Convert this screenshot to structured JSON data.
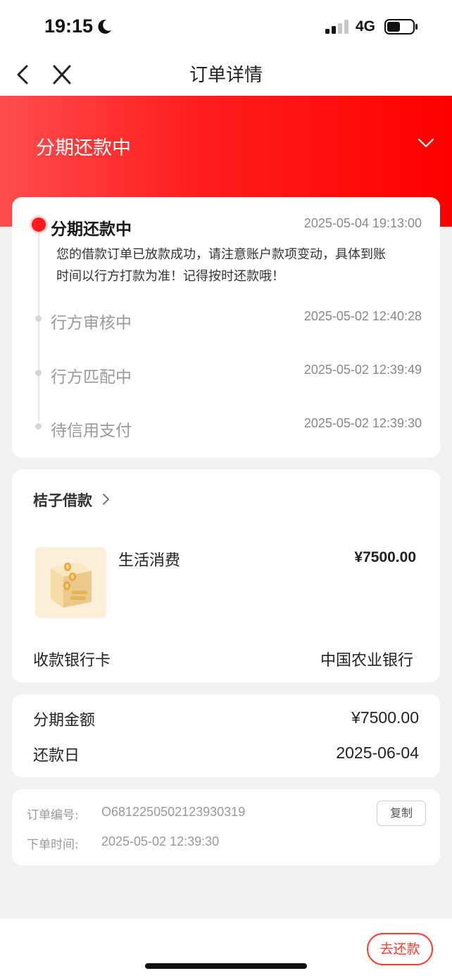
{
  "status_bar": {
    "time": "19:15",
    "network": "4G",
    "icons": [
      "moon-icon",
      "signal-icon",
      "battery-icon"
    ]
  },
  "nav": {
    "title": "订单详情",
    "back_icon": "chevron-left-icon",
    "close_icon": "close-icon"
  },
  "header": {
    "status_title": "分期还款中",
    "expand_icon": "chevron-down-icon"
  },
  "timeline": {
    "steps": [
      {
        "title": "分期还款中",
        "time": "2025-05-04 19:13:00",
        "description_line1": "您的借款订单已放款成功，请注意账户款项变动，具体到账",
        "description_line2": "时间以行方打款为准！记得按时还款哦！",
        "active": true
      },
      {
        "title": "行方审核中",
        "time": "2025-05-02 12:40:28",
        "active": false
      },
      {
        "title": "行方匹配中",
        "time": "2025-05-02 12:39:49",
        "active": false
      },
      {
        "title": "待信用支付",
        "time": "2025-05-02 12:39:30",
        "active": false
      }
    ]
  },
  "product": {
    "name": "桔子借款",
    "item_label": "生活消费",
    "item_amount": "¥7500.00",
    "bank_label": "收款银行卡",
    "bank_value": "中国农业银行"
  },
  "installment": {
    "amount_label": "分期金额",
    "amount_value": "¥7500.00",
    "due_label": "还款日",
    "due_value": "2025-06-04"
  },
  "order": {
    "number_label": "订单编号:",
    "number_value": "O6812250502123930319",
    "copy_label": "复制",
    "time_label": "下单时间:",
    "time_value": "2025-05-02 12:39:30"
  },
  "bottom": {
    "repay_label": "去还款"
  },
  "colors": {
    "accent": "#ff1a1a",
    "header_gradient_start": "#ff4d4f",
    "header_gradient_end": "#ff0000",
    "button_border": "#ff3b30"
  }
}
